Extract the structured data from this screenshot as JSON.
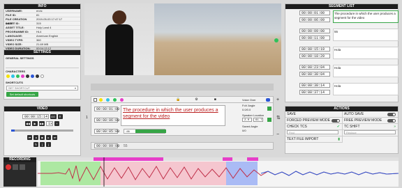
{
  "info": {
    "title": "INFO",
    "fields": [
      {
        "k": "USERNAME:",
        "v": "enric"
      },
      {
        "k": "FILE ID:",
        "v": "81"
      },
      {
        "k": "FILE CREATION DATE:",
        "v": "2019-05-03 17:47:17"
      },
      {
        "k": "ASSET ID:",
        "v": "315"
      },
      {
        "k": "ASSET TITLE:",
        "v": "Holy Land 4"
      },
      {
        "k": "PROGRAMME ID:",
        "v": "HL4"
      },
      {
        "k": "LANGUAGE:",
        "v": "American English"
      },
      {
        "k": "VIDEO TYPE:",
        "v": "360"
      },
      {
        "k": "VIDEO SIZE:",
        "v": "21.69 MB"
      },
      {
        "k": "VIDEO DURATION:",
        "v": "00:04:13.12"
      }
    ]
  },
  "settings": {
    "title": "SETTINGS",
    "general_label": "GENERAL SETTINGS",
    "characters_label": "CHARACTERS",
    "shortcuts_label": "SHORTCUTS",
    "shortcut_select": "SET SHORTCUT",
    "default_button": "Set default shortcuts",
    "character_colors": [
      "#f5e200",
      "#2ec4e6",
      "#2fc25a",
      "#e63ec9",
      "#333333",
      "#2b56d6",
      "#333333",
      "#ffffff"
    ]
  },
  "video": {
    "title": "VIDEO",
    "timecode": "00:00:15:14",
    "speed": "1x"
  },
  "recording": {
    "title": "RECORDING"
  },
  "editor": {
    "segment_number": "1",
    "tc_in": "00:00:01:00",
    "tc_out": "00:00:06:09",
    "duration": "00:00:05:09",
    "text": "The procedure in which the user produces a segment for the video",
    "cps_value": "-95",
    "voice_over_label": "Voice Over",
    "fov_angle_label": "FoV Angle",
    "fov_angle_value": "0.0/0.0",
    "speaker_location_label": "Speaker Location",
    "speaker_x": "2.0",
    "speaker_y": "61.7",
    "saved_angle_label": "Saved Angle",
    "saved_angle_value": "0/0",
    "bottom_tc": "00:00:09:00",
    "bottom_value": "55"
  },
  "segment_list": {
    "title": "SEGMENT LIST",
    "segments": [
      {
        "tc_in": "00:00:01:00",
        "tc_out": "00:00:06:09",
        "text": "The procedure in which the user produces a segment for the video"
      },
      {
        "tc_in": "00:00:09:00",
        "tc_out": "00:00:11:09",
        "text": "55"
      },
      {
        "tc_in": "00:00:15:19",
        "tc_out": "00:00:18:29",
        "text": "Hola"
      },
      {
        "tc_in": "00:00:23:04",
        "tc_out": "00:00:30:04",
        "text": "Hola"
      },
      {
        "tc_in": "00:00:30:14",
        "tc_out": "00:00:37:14",
        "text": "Hola"
      }
    ]
  },
  "actions": {
    "title": "ACTIONS",
    "save": "SAVE",
    "auto_save": "AUTO SAVE",
    "forced_preview": "FORCED PREVIEW MODE",
    "free_preview": "FREE PREVIEW MODE",
    "check_tcs": "CHECK TCS",
    "tc_shift": "TC SHIFT",
    "find_placeholder": "Find",
    "replace_placeholder": "Replace",
    "text_file_import": "TEXT FILE IMPORT"
  }
}
